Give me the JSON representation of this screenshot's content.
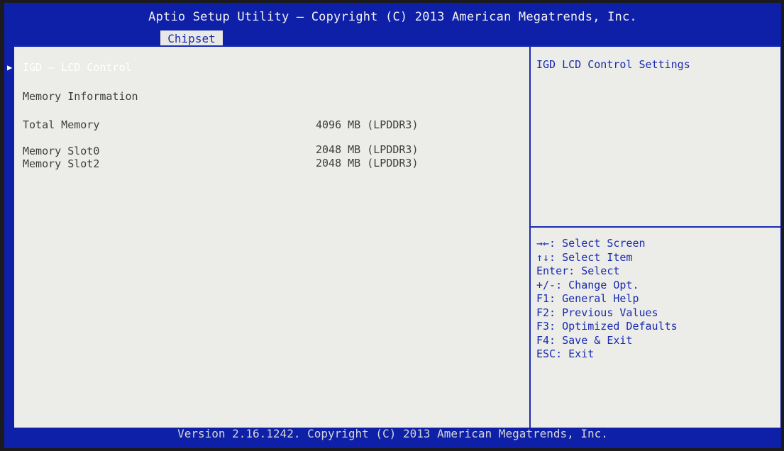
{
  "header": {
    "title": "Aptio Setup Utility – Copyright (C) 2013 American Megatrends, Inc.",
    "active_tab": "Chipset"
  },
  "menu": {
    "submenu": "IGD – LCD Control",
    "memory_info_heading": "Memory Information",
    "total_memory": {
      "label": "Total Memory",
      "value": "4096 MB (LPDDR3)"
    },
    "slot0": {
      "label": "Memory Slot0",
      "value": "2048 MB (LPDDR3)"
    },
    "slot2": {
      "label": "Memory Slot2",
      "value": "2048 MB (LPDDR3)"
    }
  },
  "help": {
    "description": "IGD LCD Control Settings",
    "keys": [
      "→←: Select Screen",
      "↑↓: Select Item",
      "Enter: Select",
      "+/-: Change Opt.",
      "F1: General Help",
      "F2: Previous Values",
      "F3: Optimized Defaults",
      "F4: Save & Exit",
      "ESC: Exit"
    ]
  },
  "footer": {
    "text": "Version 2.16.1242. Copyright (C) 2013 American Megatrends, Inc."
  },
  "colors": {
    "frame_blue": "#0e1fa8",
    "panel_bg": "#ecece8",
    "help_blue": "#1a2bb0",
    "label_gray": "#3e3e3e"
  }
}
